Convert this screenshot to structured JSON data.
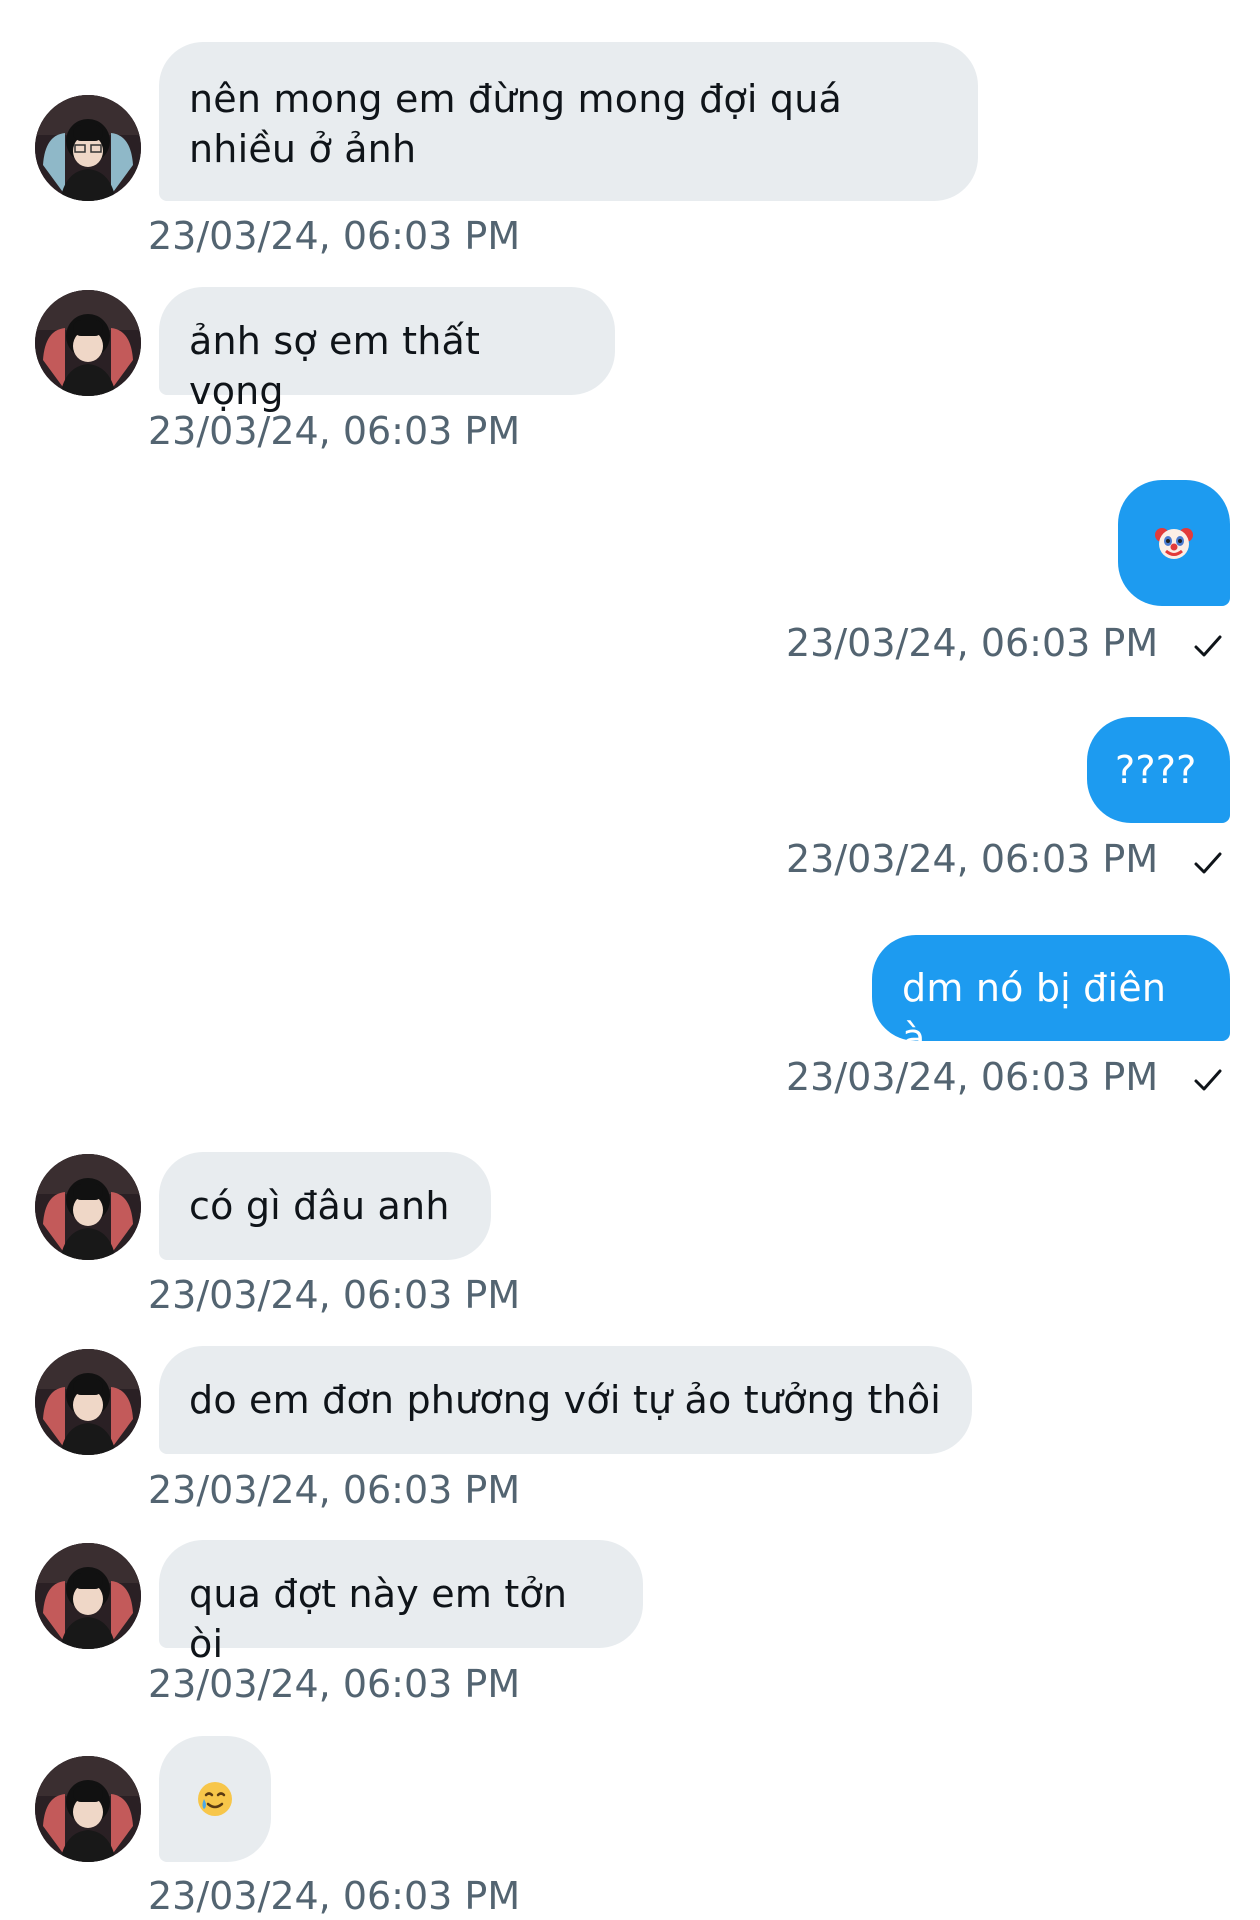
{
  "conversation": {
    "messages": [
      {
        "direction": "incoming",
        "text": "nên mong em đừng mong đợi quá nhiều ở ảnh",
        "time": "23/03/24, 06:03 PM"
      },
      {
        "direction": "incoming",
        "text": "ảnh sợ em thất vọng",
        "time": "23/03/24, 06:03 PM"
      },
      {
        "direction": "outgoing",
        "text": "🤡",
        "emoji": "clown-face",
        "time": "23/03/24, 06:03 PM",
        "status": "sent"
      },
      {
        "direction": "outgoing",
        "text": "????",
        "time": "23/03/24, 06:03 PM",
        "status": "sent"
      },
      {
        "direction": "outgoing",
        "text": "dm nó bị điên à",
        "time": "23/03/24, 06:03 PM",
        "status": "sent"
      },
      {
        "direction": "incoming",
        "text": "có gì đâu anh",
        "time": "23/03/24, 06:03 PM"
      },
      {
        "direction": "incoming",
        "text": "do em đơn phương với tự ảo tưởng thôi",
        "time": "23/03/24, 06:03 PM"
      },
      {
        "direction": "incoming",
        "text": "qua đợt này em tởn òi",
        "time": "23/03/24, 06:03 PM"
      },
      {
        "direction": "incoming",
        "text": "🥲",
        "emoji": "smiling-face-with-tear",
        "time": "23/03/24, 06:03 PM"
      }
    ]
  },
  "colors": {
    "incoming_bubble": "#e8ecef",
    "outgoing_bubble": "#1d9bf0",
    "timestamp": "#536471",
    "text": "#0f1419"
  }
}
